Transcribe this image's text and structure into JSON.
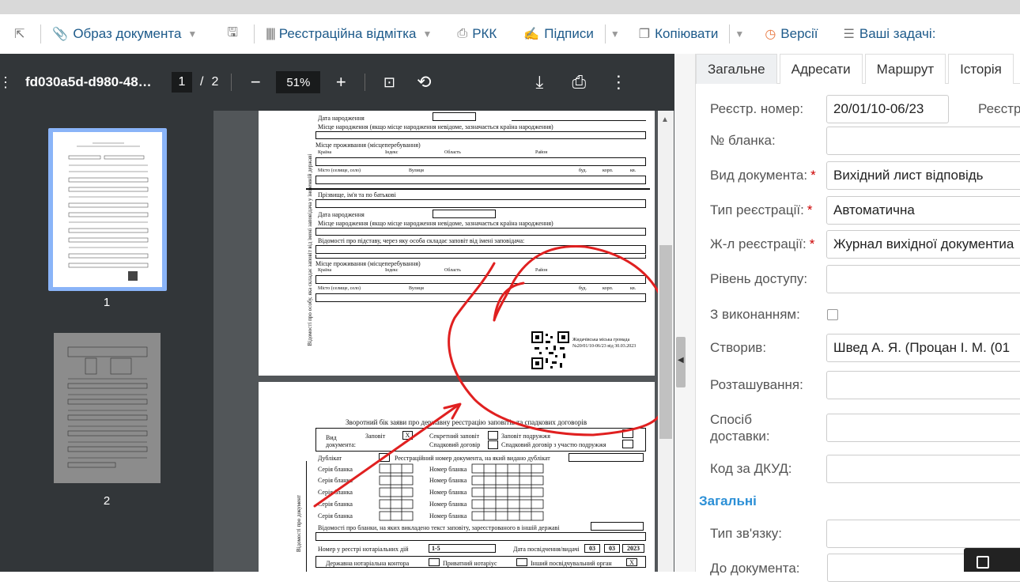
{
  "toolbar": {
    "items": [
      "Образ документа",
      "Реєстраційна відмітка",
      "РКК",
      "Підписи",
      "Копіювати",
      "Версії",
      "Ваші задачі:"
    ]
  },
  "viewer": {
    "filename": "fd030a5d-d980-48…",
    "current_page": "1",
    "total_pages": "2",
    "zoom": "51%",
    "thumb_labels": [
      "1",
      "2"
    ]
  },
  "page1": {
    "dob": "Дата народження",
    "birthplace": "Місце народження (якщо місце народження невідоме, зазначається країна народження)",
    "residence": "Місце проживання (місцеперебування)",
    "country": "Країна",
    "index": "Індекс",
    "oblast": "Область",
    "district": "Район",
    "city": "Місто (селище, село)",
    "street": "Вулиця",
    "bud": "буд.",
    "korp": "корп.",
    "kv": "кв.",
    "fullname": "Прізвище, ім'я та по батькові",
    "basis": "Відомості про підставу, через яку особа складає заповіт від імені заповідача:",
    "side_label": "Відомості про особу, яка складає заповіт від імені заповідача у іноземній державі",
    "stamp_line1": "Жидачівська міська громада",
    "stamp_line2": "№20/01/10-06/23 від 30.03.2023"
  },
  "page2": {
    "title": "Зворотний бік заяви про державну реєстрацію заповітів та спадкових договорів",
    "doc_type": "Вид документа:",
    "will": "Заповіт",
    "secret_will": "Секретний заповіт",
    "spouse_will": "Заповіт подружжя",
    "inherit_contract": "Спадковий договір",
    "inherit_contract_spouse": "Спадковий договір з участю подружжя",
    "duplicate": "Дублікат",
    "dup_number": "Реєстраційний номер документа, на який видано дублікат",
    "series": "Серія бланка",
    "number": "Номер бланка",
    "foreign": "Відомості про бланки, на яких викладено текст заповіту, зареєстрованого в іншій державі",
    "reg_no": "Номер у реєстрі нотаріальних дій",
    "reg_val": "1-5",
    "cert_date": "Дата посвідчення/видачі",
    "d1": "03",
    "d2": "03",
    "d3": "2023",
    "state_notary": "Державна нотаріальна контора",
    "private_notary": "Приватний нотаріус",
    "other_body": "Інший посвідчувальний орган",
    "side_label": "Відомості про документ",
    "mark": "X"
  },
  "panel": {
    "tabs": [
      "Загальне",
      "Адресати",
      "Маршрут",
      "Історія"
    ],
    "fields": [
      {
        "label": "Реєстр. номер:",
        "value": "20/01/10-06/23",
        "required": false
      },
      {
        "label": "№ бланка:",
        "value": "",
        "required": false
      },
      {
        "label": "Вид документа:",
        "value": "Вихідний лист відповідь",
        "required": true
      },
      {
        "label": "Тип реєстрації:",
        "value": "Автоматична",
        "required": true
      },
      {
        "label": "Ж-л реєстрації:",
        "value": "Журнал вихідної документиа",
        "required": true
      },
      {
        "label": "Рівень доступу:",
        "value": "",
        "required": false
      },
      {
        "label": "З виконанням:",
        "value": "",
        "required": false
      },
      {
        "label": "Створив:",
        "value": "Швед  А. Я. (Процан  І. М. (01",
        "required": false
      },
      {
        "label": "Розташування:",
        "value": "",
        "required": false
      },
      {
        "label": "Спосіб доставки:",
        "value": "",
        "required": false
      },
      {
        "label": "Код за ДКУД:",
        "value": "",
        "required": false
      }
    ],
    "reg_label2": "Реєстр",
    "section": "Загальні",
    "link_type": "Тип зв'язку:",
    "to_doc": "До документа:"
  },
  "colors": {
    "link": "#1d5a8a",
    "section": "#2b8fd6",
    "annotation": "#e02020",
    "required": "#cc0000"
  }
}
